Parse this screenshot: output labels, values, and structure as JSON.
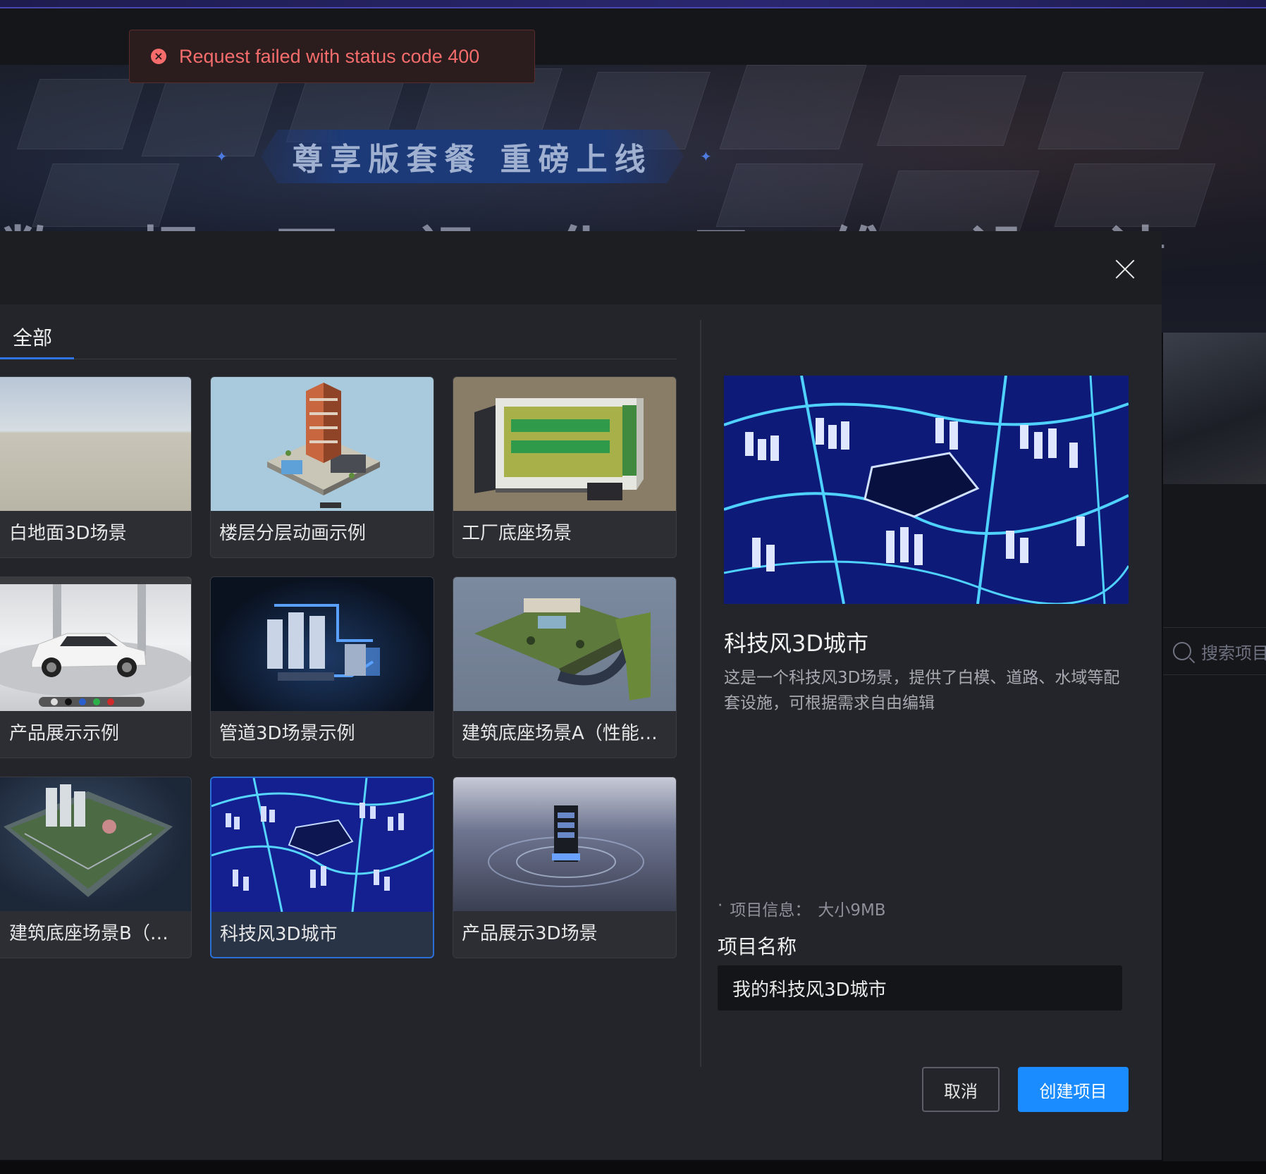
{
  "toast": {
    "icon": "error-icon",
    "message": "Request failed with status code 400",
    "color": "#f56c6c"
  },
  "banner": {
    "ribbon_text": "尊享版套餐 重磅上线",
    "big_text": "数 据 可 视 化 三 维 设 计 ·"
  },
  "background": {
    "search_placeholder": "搜索项目"
  },
  "modal": {
    "close_icon": "close-icon",
    "tabs": [
      {
        "label": "全部",
        "active": true
      }
    ],
    "templates": [
      {
        "label": "白地面3D场景",
        "selected": false
      },
      {
        "label": "楼层分层动画示例",
        "selected": false
      },
      {
        "label": "工厂底座场景",
        "selected": false
      },
      {
        "label": "产品展示示例",
        "selected": false
      },
      {
        "label": "管道3D场景示例",
        "selected": false
      },
      {
        "label": "建筑底座场景A（性能…",
        "selected": false
      },
      {
        "label": "建筑底座场景B（视觉…",
        "selected": false
      },
      {
        "label": "科技风3D城市",
        "selected": true
      },
      {
        "label": "产品展示3D场景",
        "selected": false
      }
    ],
    "detail": {
      "title": "科技风3D城市",
      "description": "这是一个科技风3D场景，提供了白模、道路、水域等配套设施，可根据需求自由编辑",
      "info_bullet": "·",
      "info_label": "项目信息：",
      "info_value": "大小9MB",
      "name_label": "项目名称",
      "name_value": "我的科技风3D城市"
    },
    "buttons": {
      "cancel": "取消",
      "create": "创建项目"
    },
    "colors": {
      "accent": "#1a8cff",
      "tab_underline": "#2f74ea",
      "selected_border": "#2a6fd6"
    }
  }
}
